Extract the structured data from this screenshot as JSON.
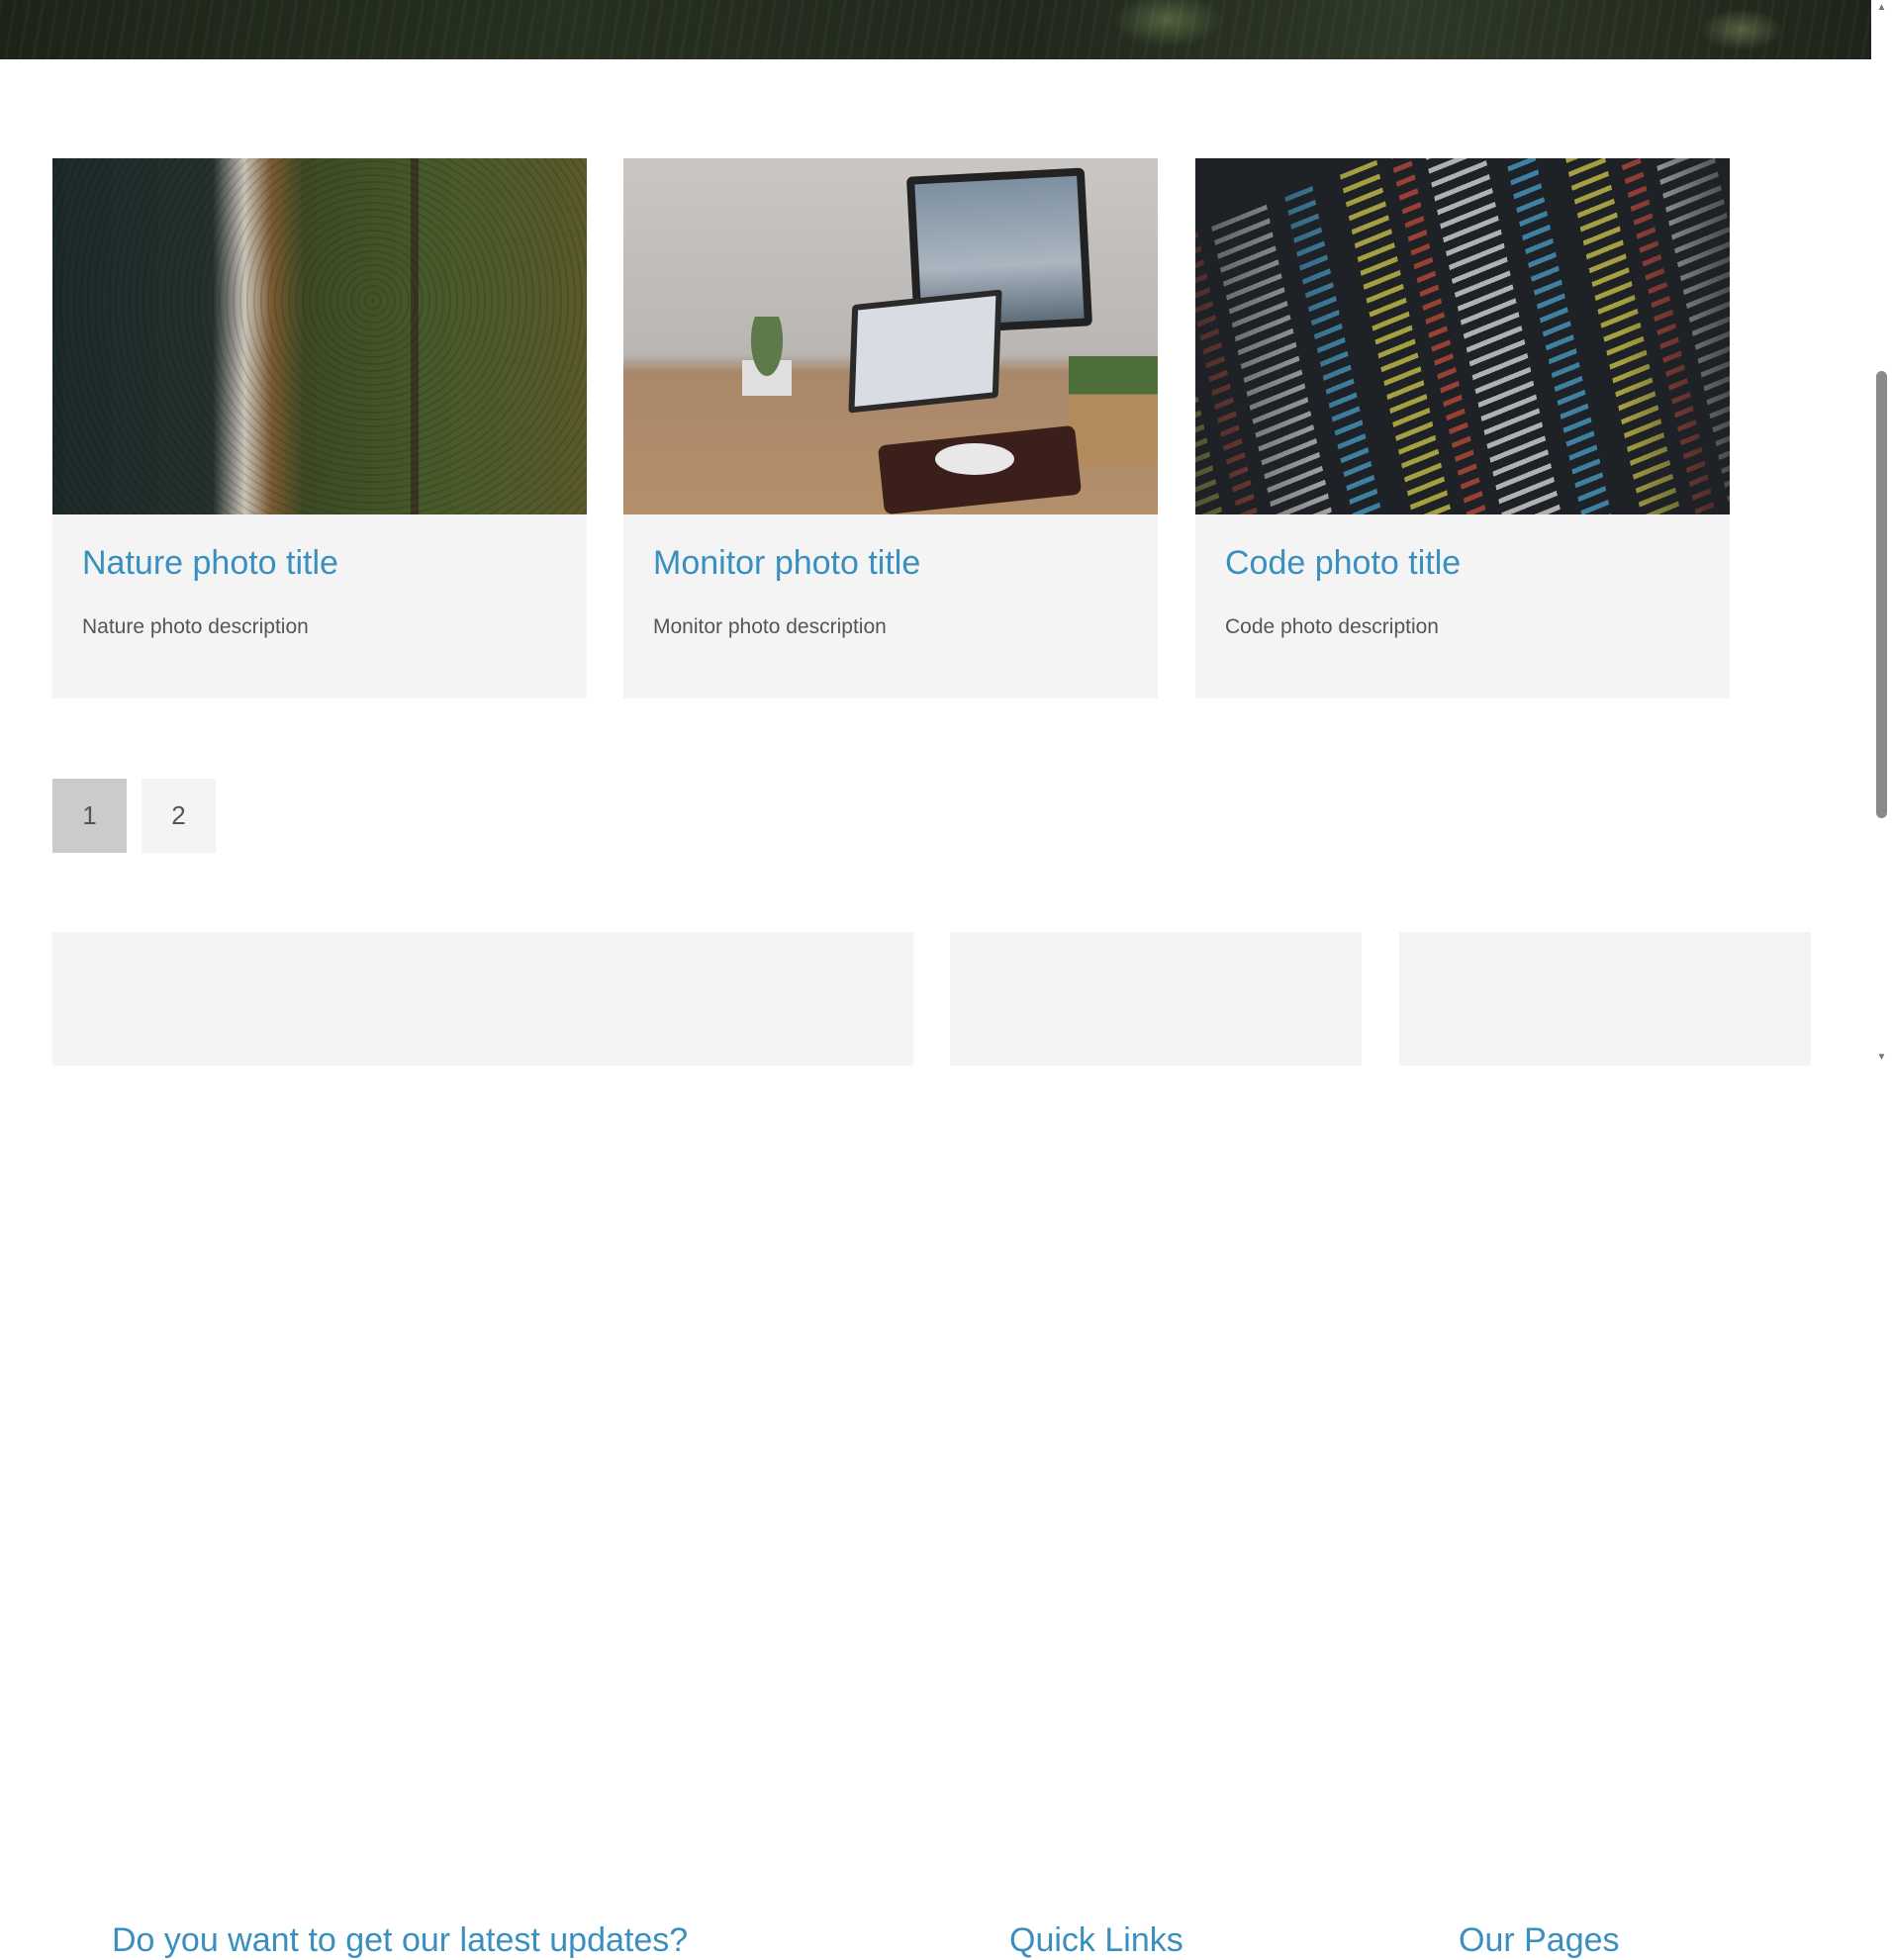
{
  "cards": [
    {
      "title": "Nature photo title",
      "description": "Nature photo description",
      "image_alt": "nature-photo"
    },
    {
      "title": "Monitor photo title",
      "description": "Monitor photo description",
      "image_alt": "monitor-photo"
    },
    {
      "title": "Code photo title",
      "description": "Code photo description",
      "image_alt": "code-photo"
    }
  ],
  "pagination": {
    "pages": [
      "1",
      "2"
    ],
    "current": "1"
  },
  "footer": {
    "newsletter_heading": "Do you want to get our latest updates?",
    "quick_links_heading": "Quick Links",
    "our_pages_heading": "Our Pages"
  },
  "colors": {
    "accent": "#3a8fc1",
    "card_bg": "#f4f4f4",
    "active_page_bg": "#cbcbcb"
  },
  "scrollbar": {
    "up_icon": "triangle-up-icon",
    "down_icon": "triangle-down-icon"
  }
}
